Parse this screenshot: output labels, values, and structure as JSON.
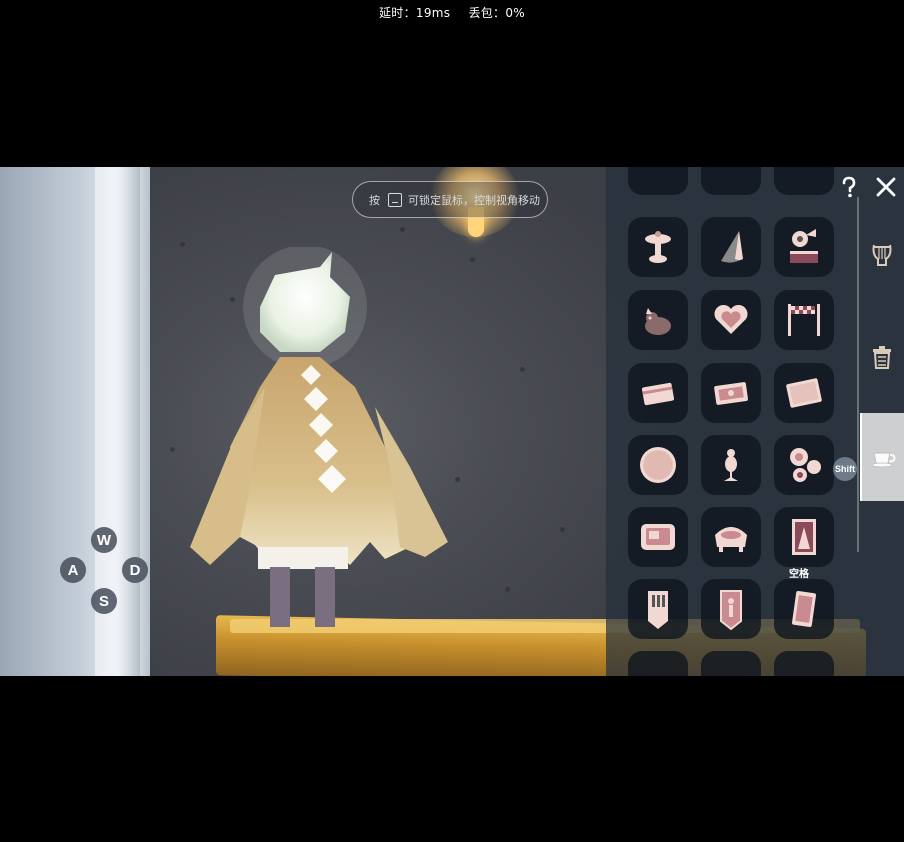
{
  "stats": {
    "latency": "延时：19ms",
    "packet_loss": "丢包：0%"
  },
  "hint": {
    "prefix": "按",
    "text": "可锁定鼠标，控制视角移动"
  },
  "wasd": {
    "up": "W",
    "left": "A",
    "right": "D",
    "down": "S"
  },
  "panel": {
    "shift_label": "Shift",
    "space_label": "空格",
    "slots": [
      {
        "icon": "partial-slot-icon"
      },
      {
        "icon": "partial-slot-icon"
      },
      {
        "icon": "partial-slot-icon"
      },
      {
        "icon": "fountain-icon"
      },
      {
        "icon": "cone-shell-icon"
      },
      {
        "icon": "gramophone-icon"
      },
      {
        "icon": "plush-toy-icon"
      },
      {
        "icon": "heart-icon"
      },
      {
        "icon": "checkered-banner-icon"
      },
      {
        "icon": "card-icon"
      },
      {
        "icon": "ticket-icon"
      },
      {
        "icon": "mat-icon"
      },
      {
        "icon": "round-rug-icon"
      },
      {
        "icon": "mannequin-icon"
      },
      {
        "icon": "dessert-plates-icon"
      },
      {
        "icon": "framed-picture-icon"
      },
      {
        "icon": "bathtub-icon"
      },
      {
        "icon": "poster-icon"
      },
      {
        "icon": "piano-banner-icon"
      },
      {
        "icon": "figure-banner-icon"
      },
      {
        "icon": "tall-card-icon"
      },
      {
        "icon": "partial-slot-icon"
      },
      {
        "icon": "partial-slot-icon"
      },
      {
        "icon": "partial-slot-icon"
      }
    ],
    "tabs": [
      {
        "icon": "lyre-icon"
      },
      {
        "icon": "trash-can-icon"
      },
      {
        "icon": "teacup-icon",
        "active": true
      }
    ]
  },
  "colors": {
    "icon": "#f1d8d2",
    "slot_bg": "#0e141e",
    "panel_bg": "#26303c"
  }
}
